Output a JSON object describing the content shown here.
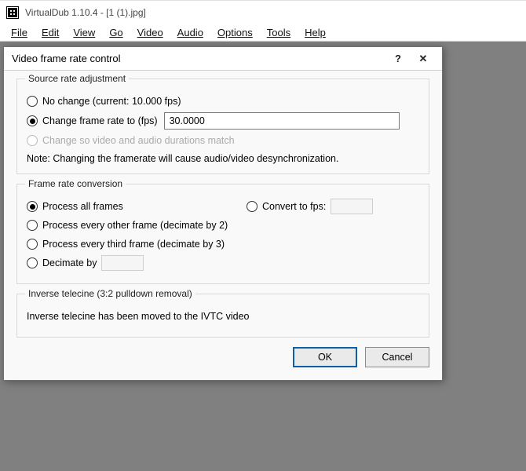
{
  "main": {
    "title": "VirtualDub 1.10.4 - [1 (1).jpg]",
    "menu": {
      "file": "File",
      "edit": "Edit",
      "view": "View",
      "go": "Go",
      "video": "Video",
      "audio": "Audio",
      "options": "Options",
      "tools": "Tools",
      "help": "Help"
    }
  },
  "dialog": {
    "title": "Video frame rate control",
    "help_glyph": "?",
    "close_glyph": "✕",
    "source_rate": {
      "legend": "Source rate adjustment",
      "no_change": "No change (current: 10.000 fps)",
      "change_to": "Change frame rate to (fps)",
      "change_to_value": "30.0000",
      "match_durations": "Change so video and audio durations match",
      "note": "Note: Changing the framerate will cause audio/video desynchronization."
    },
    "conversion": {
      "legend": "Frame rate conversion",
      "process_all": "Process all frames",
      "every_other": "Process every other frame (decimate by 2)",
      "every_third": "Process every third frame (decimate by 3)",
      "decimate_by": "Decimate by",
      "decimate_by_value": "",
      "convert_to_fps": "Convert to fps:",
      "convert_to_fps_value": ""
    },
    "ivtc": {
      "legend": "Inverse telecine (3:2 pulldown removal)",
      "message": "Inverse telecine has been moved to the IVTC video"
    },
    "buttons": {
      "ok": "OK",
      "cancel": "Cancel"
    }
  }
}
